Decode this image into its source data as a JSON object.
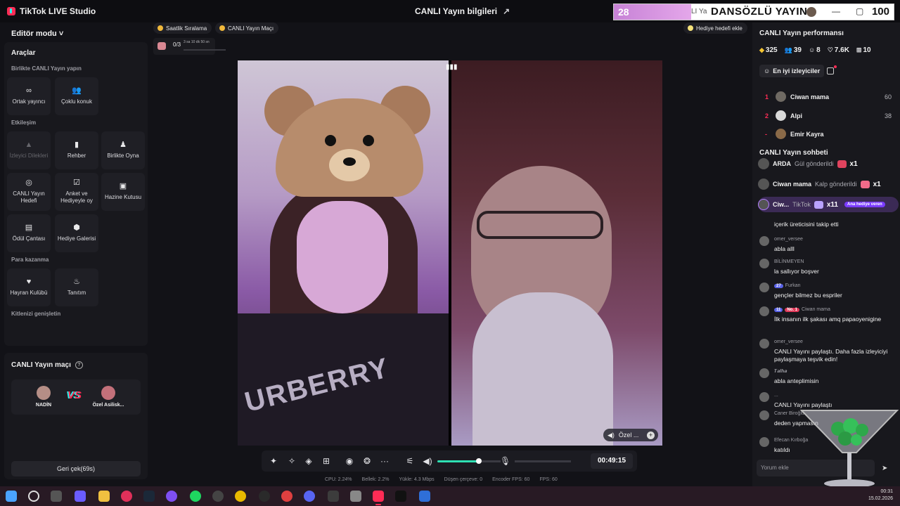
{
  "app": {
    "title": "TikTok LIVE Studio",
    "center_title": "CANLI Yayın bilgileri"
  },
  "overlay": {
    "count": "28",
    "label": "LI Ya",
    "title": "DANSÖZLÜ YAYIN",
    "number": "100"
  },
  "left": {
    "edit_mode": "Editör modu",
    "tools_title": "Araçlar",
    "section_collab": "Birlikte CANLI Yayın yapın",
    "tile_cohost": "Ortak yayıncı",
    "tile_multiguest": "Çoklu konuk",
    "section_interaction": "Etkileşim",
    "tile_viewer_requests": "İzleyici Dilekleri",
    "tile_guide": "Rehber",
    "tile_play_together": "Birlikte Oyna",
    "tile_live_goal": "CANLI Yayın Hedefi",
    "tile_poll": "Anket ve Hediyeyle oy",
    "tile_treasure": "Hazine Kutusu",
    "tile_reward_bag": "Ödül Çantası",
    "tile_gift_gallery": "Hediye Galerisi",
    "section_monetize": "Para kazanma",
    "tile_fan_club": "Hayran Kulübü",
    "tile_promote": "Tanıtım",
    "section_expand": "Kitlenizi genişletin",
    "match_title": "CANLI Yayın maçı",
    "player1": "NADİN",
    "player2": "Özel Asilisk...",
    "vs": "VS",
    "retract": "Geri çek(69s)"
  },
  "center": {
    "pill_hourly": "Saatlik Sıralama",
    "pill_match": "CANLI Yayın Maçı",
    "pill_gift_goal": "Hediye hedefi ekle",
    "goal_progress": "0/3",
    "goal_time": "3 sa 10 dk 50 sn",
    "guest_label": "Özel ...",
    "overlay_brand_text": "URBERRY",
    "timer": "00:49:15",
    "volume_level_percent": 65,
    "stats": {
      "cpu": "CPU: 2.24%",
      "memory": "Bellek: 2.2%",
      "upload": "Yükle: 4.3 Mbps",
      "dropped": "Düşen çerçeve: 0",
      "encoder_fps": "Encoder FPS: 60",
      "fps": "FPS: 60"
    }
  },
  "right": {
    "perf_title": "CANLI Yayın performansı",
    "perf_diamonds": "325",
    "perf_viewers": "39",
    "perf_new": "8",
    "perf_likes": "7.6K",
    "perf_gifters": "10",
    "top_viewers_tab": "En iyi izleyiciler",
    "top_viewers": [
      {
        "rank": "1",
        "name": "Ciwan mama",
        "score": "60",
        "avatar": "#6f6a63"
      },
      {
        "rank": "2",
        "name": "Alpi",
        "score": "38",
        "avatar": "#d9d9d9"
      },
      {
        "rank": "-",
        "name": "Emir Kayra",
        "score": "",
        "avatar": "#8a6a48"
      }
    ],
    "chat_title": "CANLI Yayın sohbeti",
    "gifts": [
      {
        "user": "ARDA",
        "action": "Gül gönderildi",
        "count": "x1",
        "gift_color": "#e0435e"
      },
      {
        "user": "Ciwan mama",
        "action": "Kalp gönderildi",
        "count": "x1",
        "gift_color": "#f06b8a"
      },
      {
        "user": "Ciw...",
        "action": "TikTok",
        "count": "x11",
        "gift_color": "#b9a2ff",
        "badge": "Ana hediye veren"
      }
    ],
    "messages": [
      {
        "user": "",
        "text": "içerik üreticisini takip etti"
      },
      {
        "user": "omer_versee",
        "text": "abla alll"
      },
      {
        "user": "BİLİNMEYEN",
        "text": "la sallıyor boşver"
      },
      {
        "user": "Furkan",
        "badge1": "27",
        "text": "gençler bilmez bu espriler"
      },
      {
        "user": "Ciwan mama",
        "badge1": "11",
        "badge2": "No. 1",
        "text": "İlk insanın ilk şakası amq papaoyenigine"
      },
      {
        "user": "omer_versee",
        "text": "CANLI Yayını paylaştı. Daha fazla izleyiciyi paylaşmaya teşvik edin!"
      },
      {
        "user": "𝑻𝒂𝒍𝒉𝒂",
        "text": "abla anteplimisin"
      },
      {
        "user": "...",
        "text": "CANLI Yayını paylaştı"
      },
      {
        "user": "Caner Biroğlu",
        "text": "deden yapmasın"
      },
      {
        "user": "Efecan Kırboğa",
        "text": "katıldı"
      }
    ],
    "chat_placeholder": "Yorum ekle"
  },
  "taskbar": {
    "time": "00:31",
    "date": "15.02.2026"
  },
  "colors": {
    "accent": "#fe2c55",
    "cyan": "#25f4ee",
    "volume": "#2ee0b3"
  }
}
